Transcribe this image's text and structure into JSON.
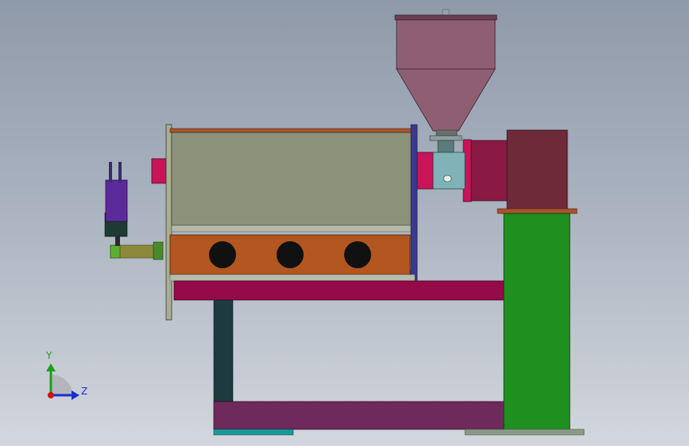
{
  "viewport": {
    "background_top": "#8f9aa9",
    "background_bottom": "#d3d7dd"
  },
  "triad": {
    "y_label": "Y",
    "z_label": "Z",
    "y_color": "#18a018",
    "z_color": "#1a2fd0",
    "origin_color": "#d01010"
  },
  "colors": {
    "hopper": "#8e5f73",
    "hopper_dark": "#6a3f54",
    "tank_body": "#8c927a",
    "tank_trim": "#a8542c",
    "heater_box": "#b3561f",
    "frame_beam": "#950a48",
    "base_beam": "#6e2a5a",
    "support_post": "#1d3a40",
    "column": "#1f8f1f",
    "gearbox": "#6f2a3a",
    "coupling": "#c9145a",
    "barrel_ring": "#7fb3b8",
    "motor_purple": "#5b2a9a",
    "motor_dark": "#1e3b33",
    "rod": "#8c8a3a",
    "teal_foot": "#1a9a9a",
    "grey_foot": "#8a9a8a",
    "panel_post": "#a8ae92"
  }
}
